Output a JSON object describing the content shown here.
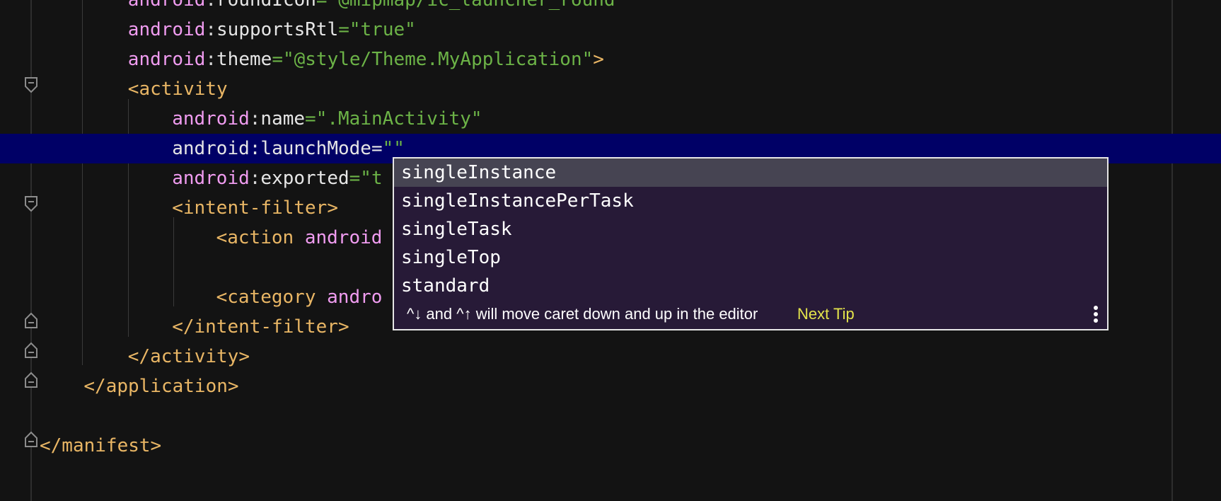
{
  "editor": {
    "lines": [
      {
        "indent": "        ",
        "tokens": [
          [
            "attr",
            "android"
          ],
          [
            "punc",
            ":"
          ],
          [
            "name",
            "roundIcon"
          ],
          [
            "str",
            "=\"@mipmap/ic_launcher_round\""
          ]
        ]
      },
      {
        "indent": "        ",
        "tokens": [
          [
            "attr",
            "android"
          ],
          [
            "punc",
            ":"
          ],
          [
            "name",
            "supportsRtl"
          ],
          [
            "str",
            "=\"true\""
          ]
        ]
      },
      {
        "indent": "        ",
        "tokens": [
          [
            "attr",
            "android"
          ],
          [
            "punc",
            ":"
          ],
          [
            "name",
            "theme"
          ],
          [
            "str",
            "=\"@style/Theme.MyApplication\""
          ],
          [
            "tag",
            ">"
          ]
        ]
      },
      {
        "indent": "        ",
        "tokens": [
          [
            "tag",
            "<activity"
          ]
        ]
      },
      {
        "indent": "            ",
        "tokens": [
          [
            "attr",
            "android"
          ],
          [
            "punc",
            ":"
          ],
          [
            "name",
            "name"
          ],
          [
            "str",
            "=\".MainActivity\""
          ]
        ]
      },
      {
        "indent": "            ",
        "tokens": [
          [
            "name",
            "android:launchMode="
          ],
          [
            "str",
            "\"\""
          ]
        ]
      },
      {
        "indent": "            ",
        "tokens": [
          [
            "attr",
            "android"
          ],
          [
            "punc",
            ":"
          ],
          [
            "name",
            "exported"
          ],
          [
            "str",
            "=\"t"
          ]
        ]
      },
      {
        "indent": "            ",
        "tokens": [
          [
            "tag",
            "<intent-filter>"
          ]
        ]
      },
      {
        "indent": "                ",
        "tokens": [
          [
            "tag",
            "<action "
          ],
          [
            "attr",
            "android"
          ]
        ]
      },
      {
        "indent": "",
        "tokens": []
      },
      {
        "indent": "                ",
        "tokens": [
          [
            "tag",
            "<category "
          ],
          [
            "attr",
            "andro"
          ]
        ]
      },
      {
        "indent": "            ",
        "tokens": [
          [
            "tag",
            "</intent-filter>"
          ]
        ]
      },
      {
        "indent": "        ",
        "tokens": [
          [
            "tag",
            "</activity>"
          ]
        ]
      },
      {
        "indent": "    ",
        "tokens": [
          [
            "tag",
            "</application>"
          ]
        ]
      },
      {
        "indent": "",
        "tokens": []
      },
      {
        "indent": "",
        "tokens": [
          [
            "tag",
            "</manifest>"
          ]
        ]
      }
    ],
    "current_line_index": 5
  },
  "completion": {
    "items": [
      "singleInstance",
      "singleInstancePerTask",
      "singleTask",
      "singleTop",
      "standard"
    ],
    "selected_index": 0,
    "tip_text": "^↓ and ^↑ will move caret down and up in the editor",
    "next_tip_label": "Next Tip"
  },
  "colors": {
    "background": "#131313",
    "current_line": "#000066",
    "attribute": "#f09cf0",
    "tag": "#e9b665",
    "string": "#6cb347",
    "popup_background": "#271a37",
    "popup_selected": "#464452",
    "next_tip": "#e3e34b"
  }
}
